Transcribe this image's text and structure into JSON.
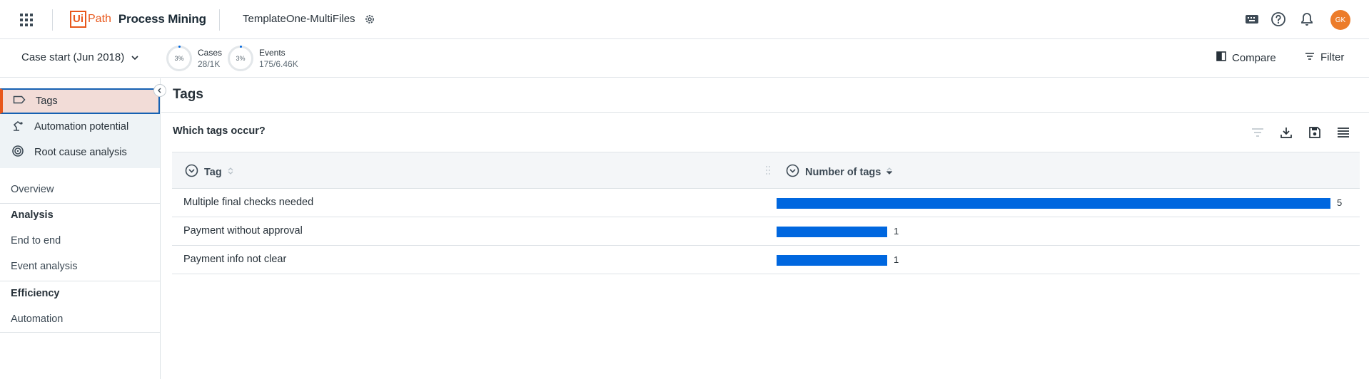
{
  "header": {
    "logo_ui": "Ui",
    "logo_path": "Path",
    "product": "Process Mining",
    "app_name": "TemplateOne-MultiFiles",
    "avatar_initials": "GK",
    "brand_color": "#e8571b",
    "icons": [
      "apps-grid-icon",
      "settings-gear-icon",
      "keyboard-icon",
      "help-icon",
      "bell-icon"
    ]
  },
  "subbar": {
    "date_filter": "Case start (Jun 2018)",
    "cases": {
      "pct": "3%",
      "label": "Cases",
      "value": "28/1K"
    },
    "events": {
      "pct": "3%",
      "label": "Events",
      "value": "175/6.46K"
    },
    "compare_label": "Compare",
    "filter_label": "Filter"
  },
  "sidebar": {
    "items": [
      {
        "label": "Tags",
        "icon": "tag-icon",
        "active": true
      },
      {
        "label": "Automation potential",
        "icon": "robot-arm-icon"
      },
      {
        "label": "Root cause analysis",
        "icon": "target-icon"
      }
    ],
    "nav": {
      "overview": "Overview",
      "analysis": "Analysis",
      "end_to_end": "End to end",
      "event_analysis": "Event analysis",
      "efficiency": "Efficiency",
      "automation": "Automation"
    }
  },
  "main": {
    "page_title": "Tags",
    "widget_title": "Which tags occur?",
    "columns": {
      "tag": "Tag",
      "count": "Number of tags"
    },
    "accent_color": "#0067df",
    "max_value": 5,
    "rows": [
      {
        "tag": "Multiple final checks needed",
        "count": 5
      },
      {
        "tag": "Payment without approval",
        "count": 1
      },
      {
        "tag": "Payment info not clear",
        "count": 1
      }
    ]
  }
}
